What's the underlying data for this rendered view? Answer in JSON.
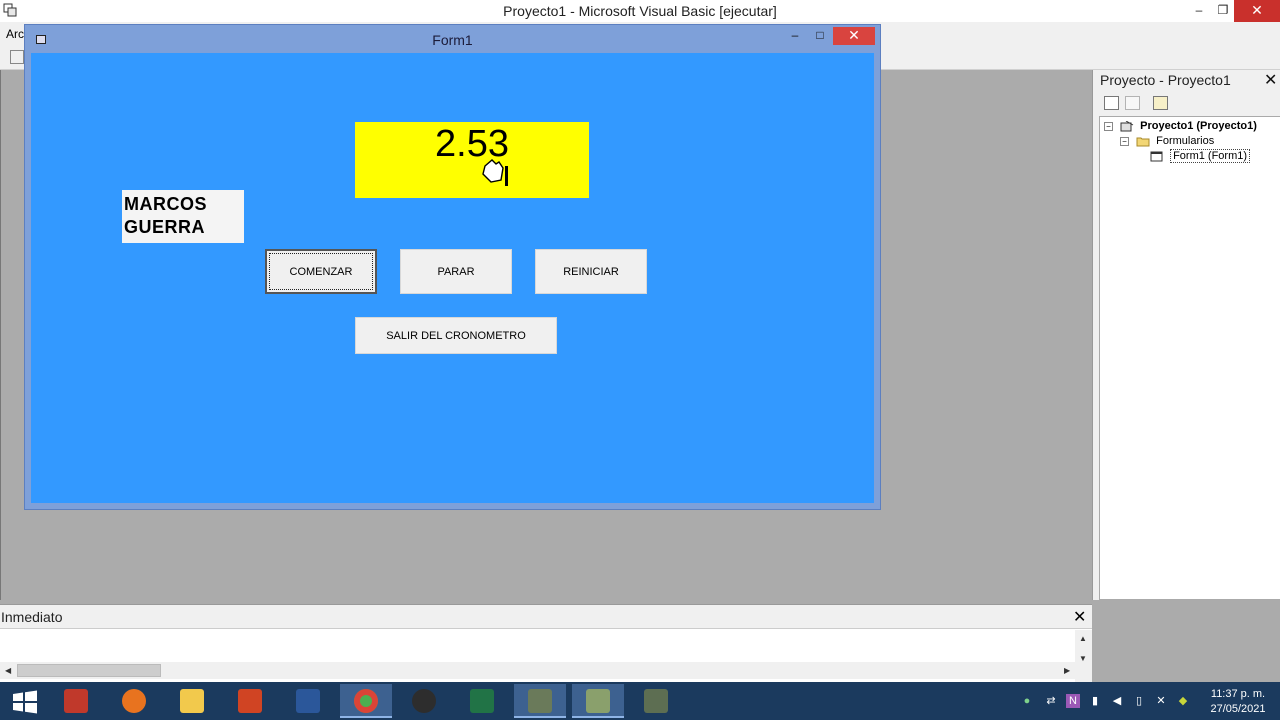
{
  "ide": {
    "title": "Proyecto1 - Microsoft Visual Basic [ejecutar]",
    "menu_first": "Arc",
    "minimize_symbol": "–",
    "restore_symbol": "❐",
    "close_symbol": "✕"
  },
  "form": {
    "title": "Form1",
    "minimize_symbol": "–",
    "maximize_symbol": "□",
    "close_symbol": "✕",
    "display_value": "2.53",
    "name_line1": "MARCOS",
    "name_line2": "GUERRA",
    "buttons": {
      "start": "COMENZAR",
      "stop": "PARAR",
      "reset": "REINICIAR",
      "exit": "SALIR DEL CRONOMETRO"
    },
    "colors": {
      "client_bg": "#3399ff",
      "display_bg": "#ffff00"
    }
  },
  "project_pane": {
    "title": "Proyecto - Proyecto1",
    "close_symbol": "✕",
    "tree": {
      "root": "Proyecto1 (Proyecto1)",
      "folder": "Formularios",
      "item": "Form1 (Form1)"
    }
  },
  "immediate_pane": {
    "title": "Inmediato",
    "close_symbol": "✕"
  },
  "taskbar": {
    "clock_time": "11:37 p. m.",
    "clock_date": "27/05/2021",
    "apps": [
      "windows-start",
      "installer",
      "firefox",
      "file-explorer",
      "powerpoint",
      "word",
      "chrome",
      "nox",
      "excel",
      "vb-ide",
      "vb-project",
      "vb-run"
    ]
  }
}
